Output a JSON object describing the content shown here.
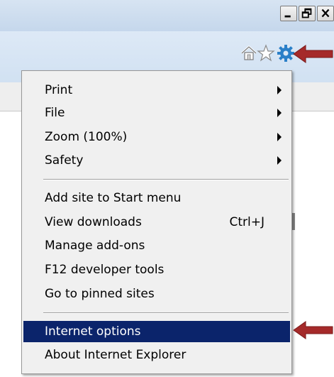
{
  "window": {
    "buttons": [
      "minimize",
      "restore",
      "close"
    ]
  },
  "toolbar": {
    "icons": [
      "home-icon",
      "favorites-star-icon",
      "tools-gear-icon"
    ]
  },
  "menu": {
    "group1": [
      {
        "label": "Print",
        "submenu": true
      },
      {
        "label": "File",
        "submenu": true
      },
      {
        "label": "Zoom (100%)",
        "submenu": true
      },
      {
        "label": "Safety",
        "submenu": true
      }
    ],
    "group2": [
      {
        "label": "Add site to Start menu"
      },
      {
        "label": "View downloads",
        "shortcut": "Ctrl+J"
      },
      {
        "label": "Manage add-ons"
      },
      {
        "label": "F12 developer tools"
      },
      {
        "label": "Go to pinned sites"
      }
    ],
    "group3": [
      {
        "label": "Internet options",
        "selected": true
      },
      {
        "label": "About Internet Explorer"
      }
    ]
  },
  "colors": {
    "selection": "#0b246b",
    "arrow": "#a52a2a",
    "gear": "#2a7fc8"
  }
}
